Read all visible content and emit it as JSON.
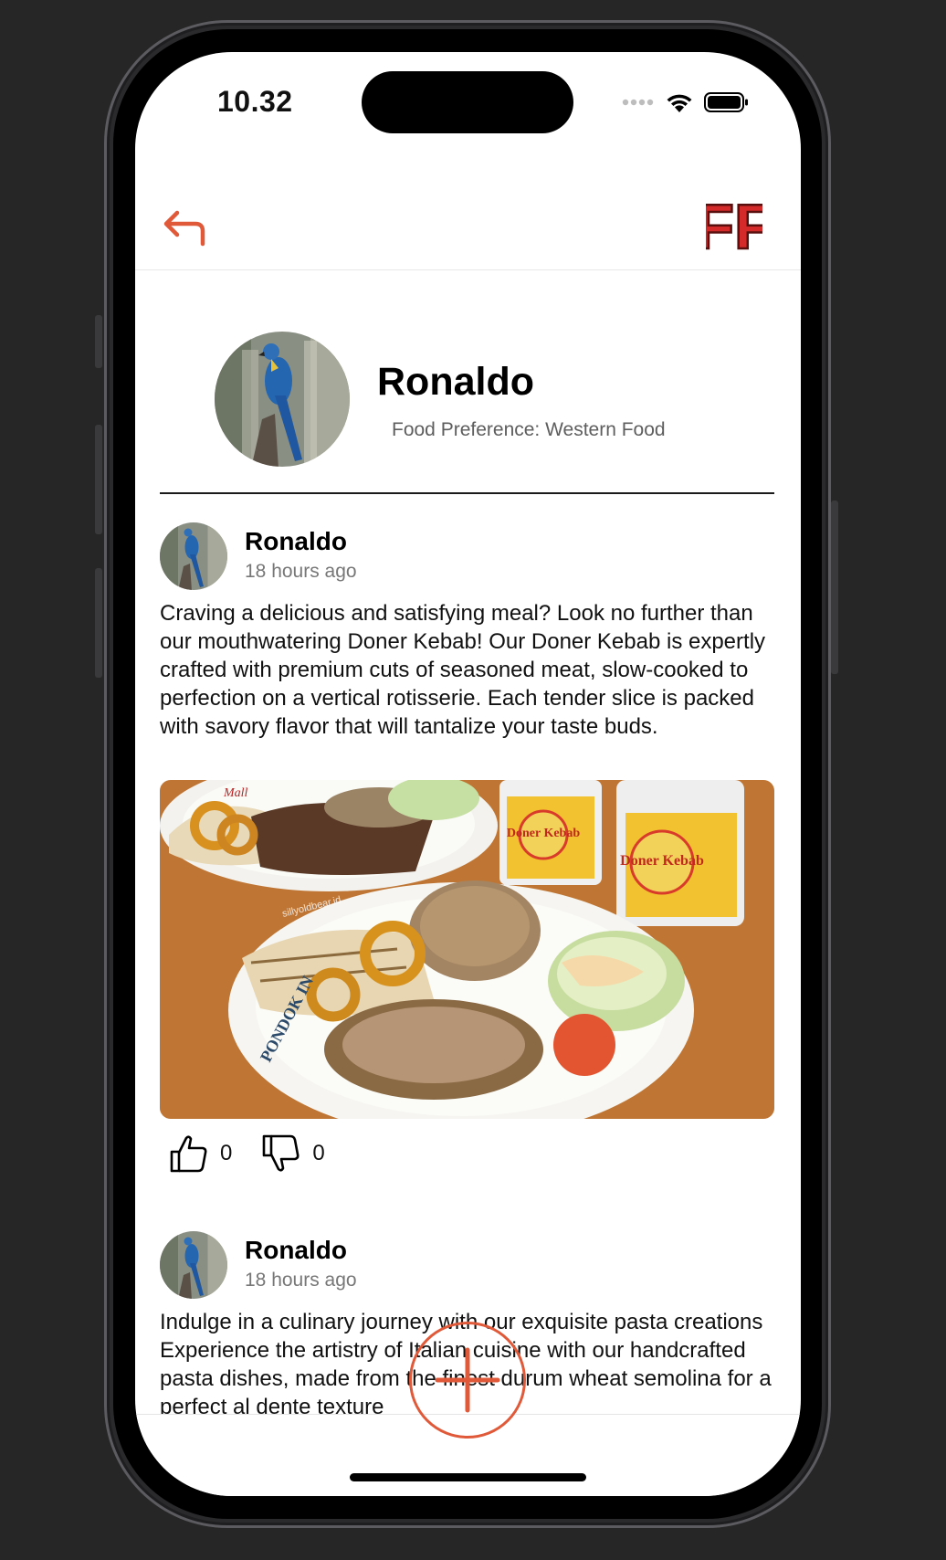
{
  "status_bar": {
    "time": "10.32"
  },
  "nav": {
    "back_icon": "back-arrow-icon",
    "logo_text": "FF"
  },
  "profile": {
    "name": "Ronaldo",
    "preference": "Food Preference: Western Food"
  },
  "posts": [
    {
      "author": "Ronaldo",
      "time": "18 hours ago",
      "text": "Craving a delicious and satisfying meal? Look no further than our mouthwatering Doner Kebab! Our Doner Kebab is expertly crafted with premium cuts of seasoned meat, slow-cooked to perfection on a vertical rotisserie. Each tender slice is packed with savory flavor that will tantalize your taste buds.",
      "likes": "0",
      "dislikes": "0"
    },
    {
      "author": "Ronaldo",
      "time": "18 hours ago",
      "text": "Indulge in a culinary journey with our exquisite pasta creations Experience the artistry of Italian cuisine with our handcrafted pasta dishes, made from the finest durum wheat semolina for a perfect al dente texture"
    }
  ],
  "image_text": {
    "cup_label_1": "Doner Kebab",
    "cup_label_2": "Doner Kebab",
    "plate_text": "PONDOK IN",
    "watermark": "sillyoldbear.id",
    "mall": "Mall"
  },
  "colors": {
    "accent": "#e05a3a",
    "logo_red": "#d42a2a"
  }
}
